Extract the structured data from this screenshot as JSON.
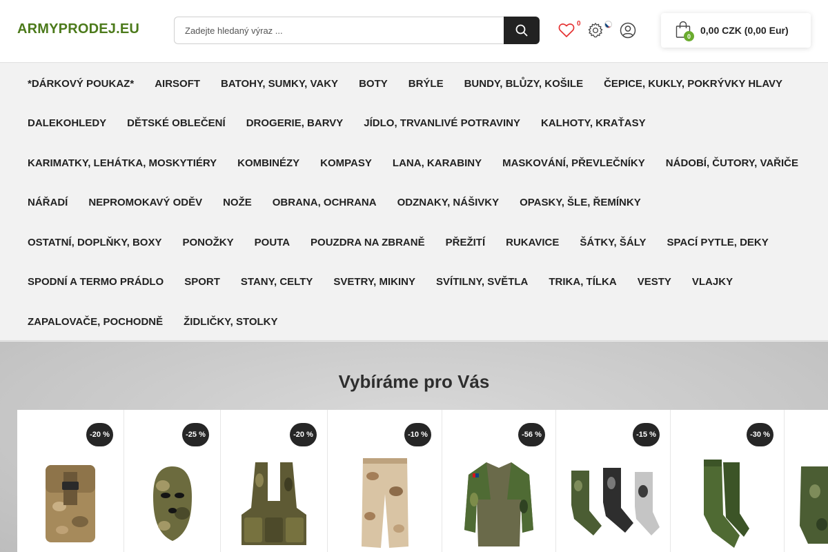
{
  "header": {
    "logo": "ARMYPRODEJ.EU",
    "search_placeholder": "Zadejte hledaný výraz ...",
    "wishlist_count": "0",
    "cart_count": "0",
    "cart_total": "0,00 CZK (0,00 Eur)"
  },
  "categories": [
    [
      "*DÁRKOVÝ POUKAZ*",
      "AIRSOFT",
      "BATOHY, SUMKY, VAKY",
      "BOTY",
      "BRÝLE",
      "BUNDY, BLŮZY, KOŠILE",
      "ČEPICE, KUKLY, POKRÝVKY HLAVY"
    ],
    [
      "DALEKOHLEDY",
      "DĚTSKÉ OBLEČENÍ",
      "DROGERIE, BARVY",
      "JÍDLO, TRVANLIVÉ POTRAVINY",
      "KALHOTY, KRAŤASY"
    ],
    [
      "KARIMATKY, LEHÁTKA, MOSKYTIÉRY",
      "KOMBINÉZY",
      "KOMPASY",
      "LANA, KARABINY",
      "MASKOVÁNÍ, PŘEVLEČNÍKY",
      "NÁDOBÍ, ČUTORY, VAŘIČE"
    ],
    [
      "NÁŘADÍ",
      "NEPROMOKAVÝ ODĚV",
      "NOŽE",
      "OBRANA, OCHRANA",
      "ODZNAKY, NÁŠIVKY",
      "OPASKY, ŠLE, ŘEMÍNKY"
    ],
    [
      "OSTATNÍ, DOPLŇKY, BOXY",
      "PONOŽKY",
      "POUTA",
      "POUZDRA NA ZBRANĚ",
      "PŘEŽITÍ",
      "RUKAVICE",
      "ŠÁTKY, ŠÁLY",
      "SPACÍ PYTLE, DEKY"
    ],
    [
      "SPODNÍ A TERMO PRÁDLO",
      "SPORT",
      "STANY, CELTY",
      "SVETRY, MIKINY",
      "SVÍTILNY, SVĚTLA",
      "TRIKA, TÍLKA",
      "VESTY",
      "VLAJKY"
    ],
    [
      "ZAPALOVAČE, POCHODNĚ",
      "ŽIDLIČKY, STOLKY"
    ]
  ],
  "promo": {
    "title": "Vybíráme pro Vás",
    "products": [
      {
        "discount": "-20 %",
        "icon": "pouch-icon"
      },
      {
        "discount": "-25 %",
        "icon": "balaclava-icon"
      },
      {
        "discount": "-20 %",
        "icon": "tactical-vest-icon"
      },
      {
        "discount": "-10 %",
        "icon": "camo-pants-icon"
      },
      {
        "discount": "-56 %",
        "icon": "combat-shirt-icon"
      },
      {
        "discount": "-15 %",
        "icon": "camo-socks-icon"
      },
      {
        "discount": "-30 %",
        "icon": "green-socks-icon"
      },
      {
        "discount": "",
        "icon": "partial-product-icon"
      }
    ]
  },
  "colors": {
    "brand": "#4c7a1b",
    "badge": "#262626",
    "cart_badge": "#6aab2e",
    "wishlist_count": "#e53030"
  }
}
